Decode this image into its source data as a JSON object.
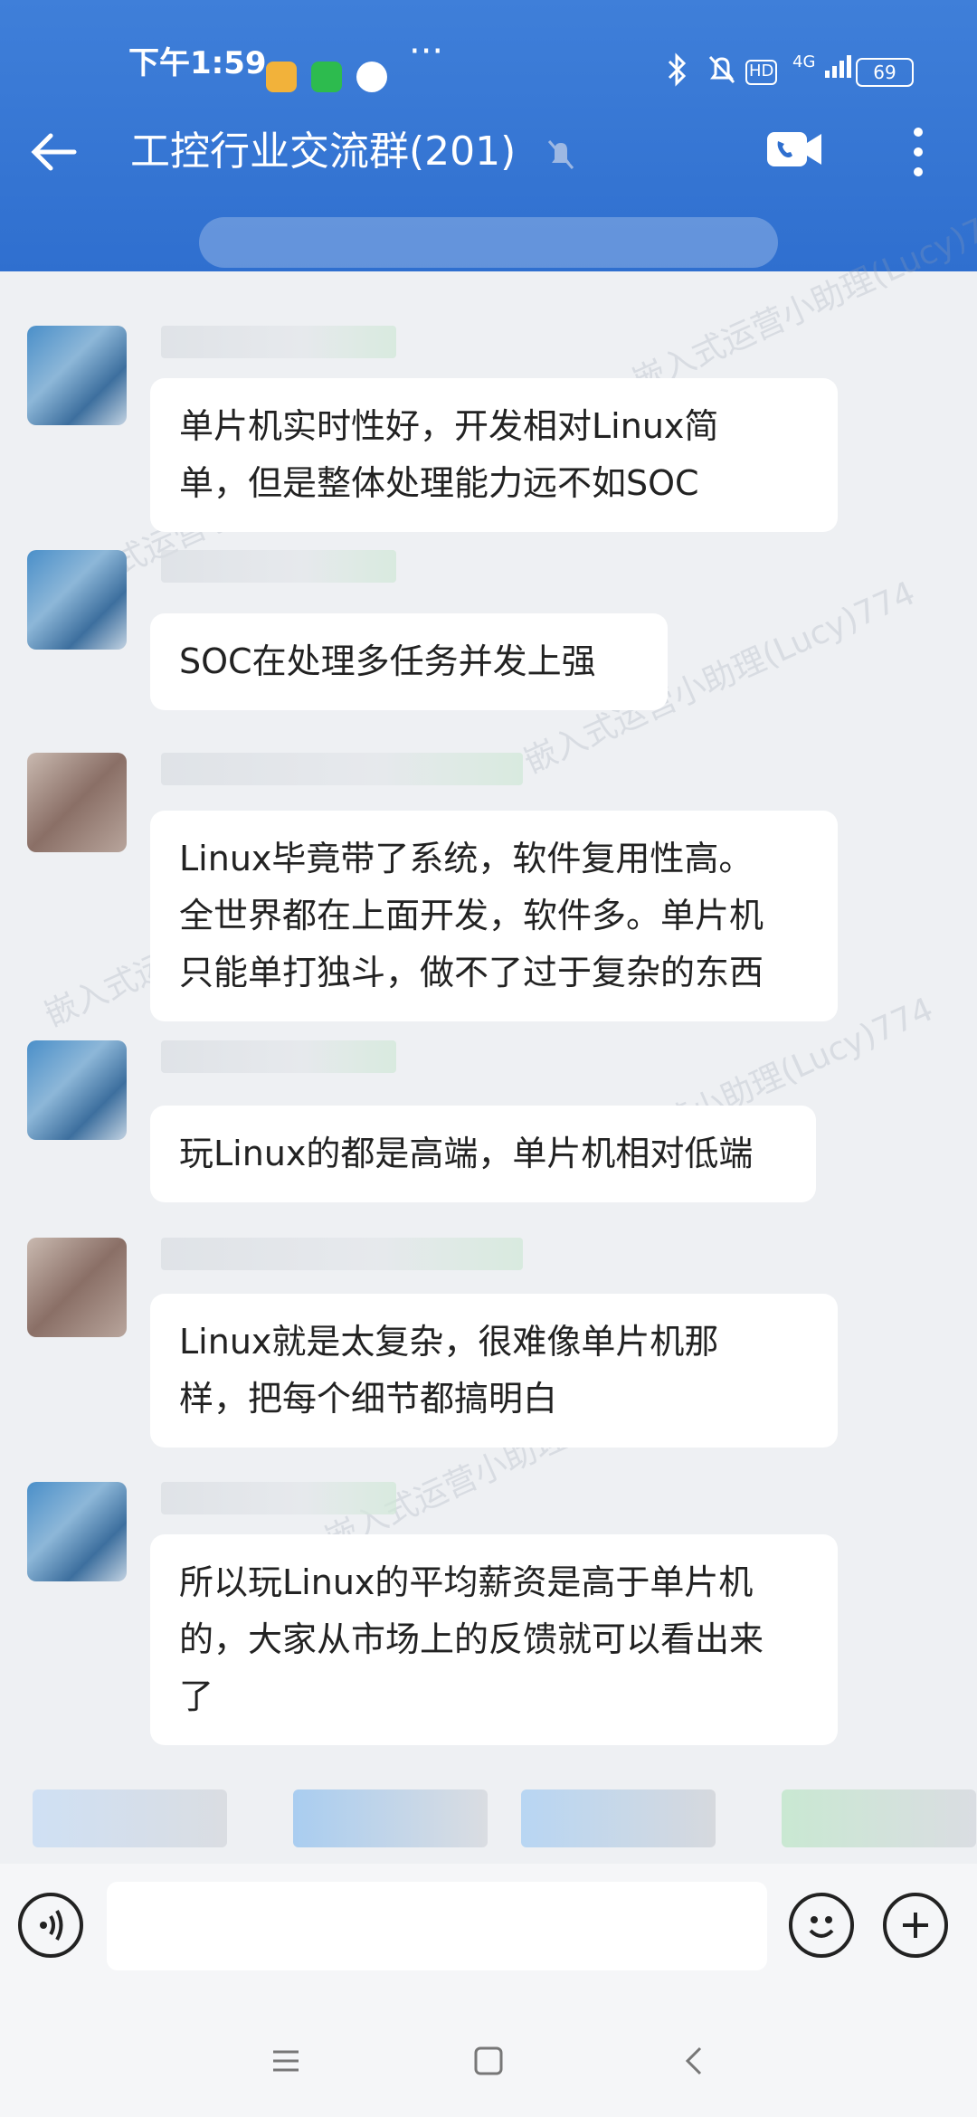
{
  "status_bar": {
    "time": "下午1:59",
    "more": "···",
    "network": "4G",
    "battery": "69"
  },
  "header": {
    "title": "工控行业交流群(201)"
  },
  "messages": [
    {
      "text": "单片机实时性好，开发相对Linux简\n单，但是整体处理能力远不如SOC"
    },
    {
      "text": "SOC在处理多任务并发上强"
    },
    {
      "text": "Linux毕竟带了系统，软件复用性高。\n全世界都在上面开发，软件多。单片机\n只能单打独斗，做不了过于复杂的东西"
    },
    {
      "text": "玩Linux的都是高端，单片机相对低端"
    },
    {
      "text": "Linux就是太复杂，很难像单片机那\n样，把每个细节都搞明白"
    },
    {
      "text": "所以玩Linux的平均薪资是高于单片机\n的，大家从市场上的反馈就可以看出来\n了"
    }
  ],
  "watermark": "嵌入式运营小助理(Lucy)774",
  "colors": {
    "header": "#2f6fcf",
    "bubble": "#ffffff",
    "chat_bg": "#eef0f3"
  },
  "icons": [
    "back-arrow-icon",
    "bell-off-icon",
    "video-call-icon",
    "more-vert-icon",
    "voice-icon",
    "emoji-icon",
    "plus-icon",
    "menu-icon",
    "home-icon",
    "back-icon"
  ]
}
